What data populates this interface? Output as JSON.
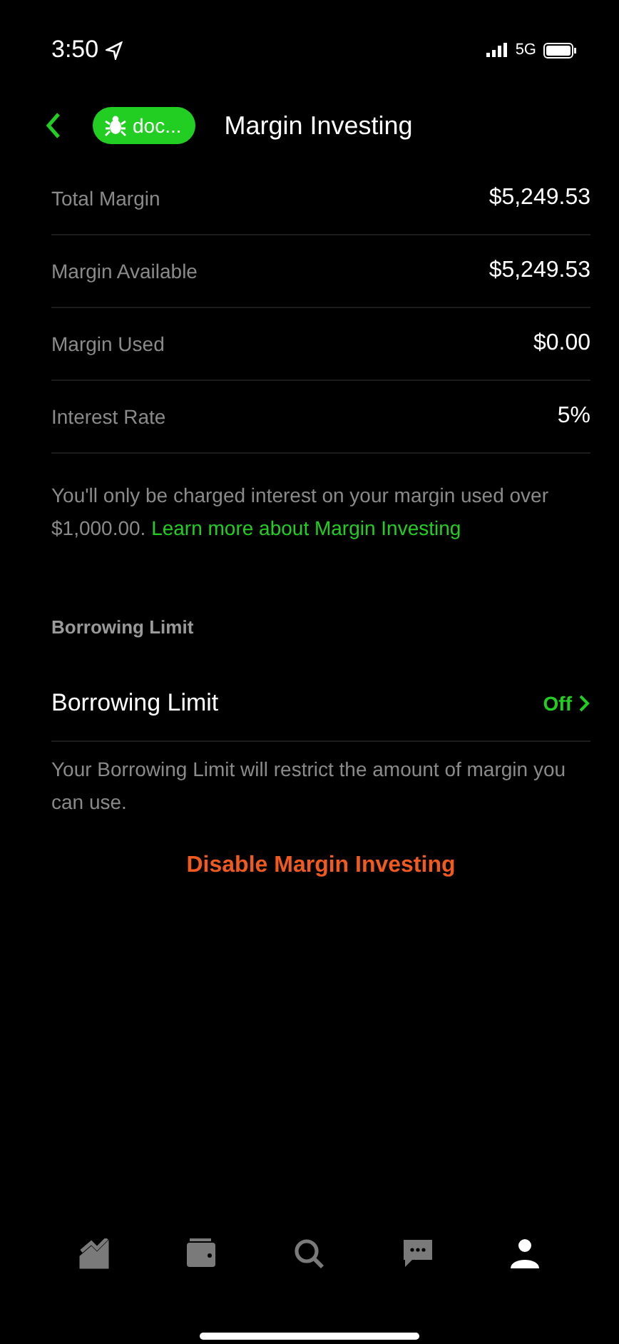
{
  "status_bar": {
    "time": "3:50",
    "network": "5G"
  },
  "header": {
    "badge": "doc...",
    "title": "Margin Investing"
  },
  "rows": [
    {
      "label": "Total Margin",
      "value": "$5,249.53"
    },
    {
      "label": "Margin Available",
      "value": "$5,249.53"
    },
    {
      "label": "Margin Used",
      "value": "$0.00"
    },
    {
      "label": "Interest Rate",
      "value": "5%"
    }
  ],
  "note": {
    "text": "You'll only be charged interest on your margin used over $1,000.00.",
    "link": "Learn more about Margin Investing"
  },
  "section": {
    "title": "Borrowing Limit",
    "row_label": "Borrowing Limit",
    "row_value": "Off",
    "note": "Your Borrowing Limit will restrict the amount of margin you can use."
  },
  "action": "Disable Margin Investing",
  "tabs": [
    {
      "kind": "chart",
      "selected": false
    },
    {
      "kind": "wallet",
      "selected": false
    },
    {
      "kind": "search",
      "selected": false
    },
    {
      "kind": "messages",
      "selected": false
    },
    {
      "kind": "profile",
      "selected": true
    }
  ]
}
